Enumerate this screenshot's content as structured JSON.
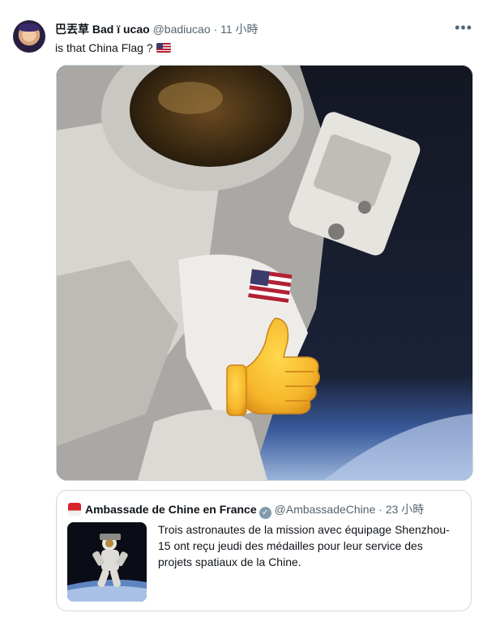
{
  "author": {
    "display_name": "巴丟草 Bad ï ucao",
    "handle": "@badiucao",
    "separator": "·",
    "time": "11 小時",
    "more_icon": "more-horizontal-icon"
  },
  "tweet": {
    "text": "is that China Flag ?",
    "emoji": "us-flag-icon"
  },
  "media": {
    "alt": "astronaut-thumbs-up-image"
  },
  "quote": {
    "display_name": "Ambassade de Chine en France",
    "verified_icon": "verified-badge-icon",
    "handle": "@AmbassadeChine",
    "separator": "·",
    "time": "23 小時",
    "text": "Trois astronautes de la mission avec équipage Shenzhou-15 ont reçu jeudi des médailles pour leur service des projets spatiaux de la Chine."
  }
}
